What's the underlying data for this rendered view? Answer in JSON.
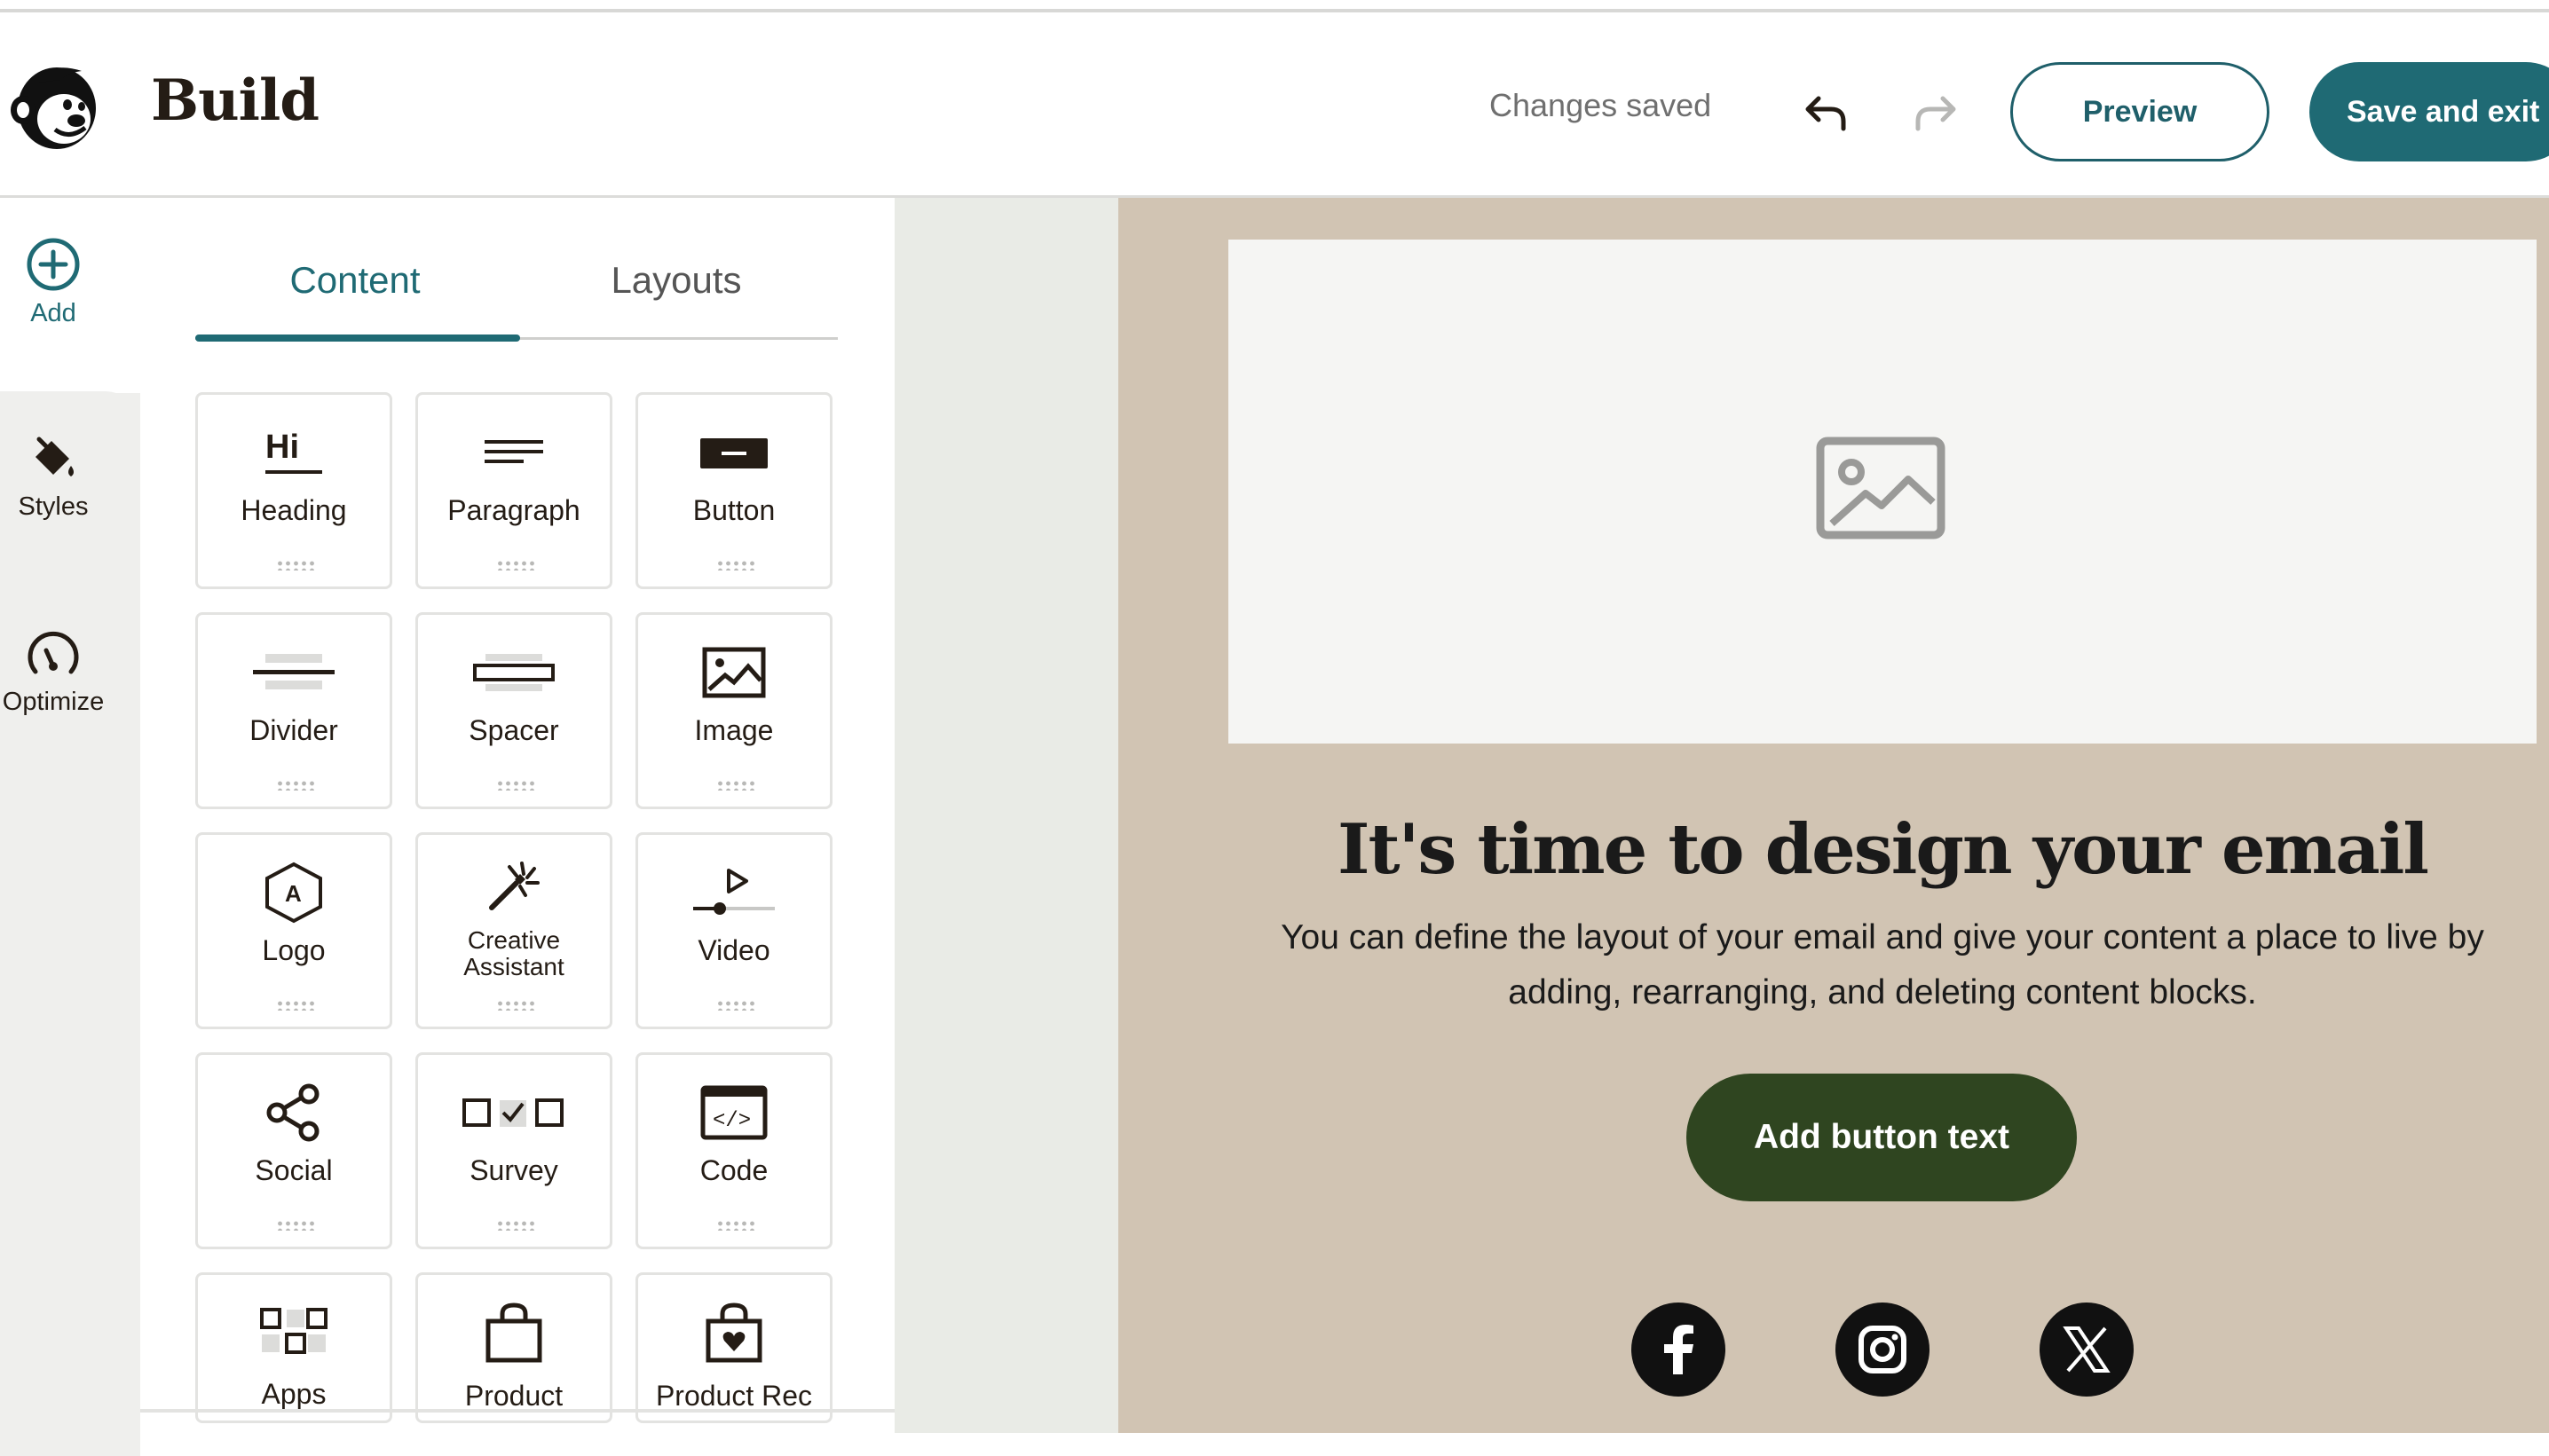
{
  "header": {
    "title": "Build",
    "status": "Changes saved",
    "preview_label": "Preview",
    "save_exit_label": "Save and exit"
  },
  "rail": {
    "items": [
      {
        "label": "Add",
        "icon": "plus-circle-icon"
      },
      {
        "label": "Styles",
        "icon": "paint-bucket-icon"
      },
      {
        "label": "Optimize",
        "icon": "gauge-icon"
      }
    ]
  },
  "panel": {
    "tabs": [
      {
        "label": "Content",
        "active": true
      },
      {
        "label": "Layouts",
        "active": false
      }
    ],
    "blocks": [
      {
        "label": "Heading",
        "icon": "heading-icon"
      },
      {
        "label": "Paragraph",
        "icon": "paragraph-icon"
      },
      {
        "label": "Button",
        "icon": "button-icon"
      },
      {
        "label": "Divider",
        "icon": "divider-icon"
      },
      {
        "label": "Spacer",
        "icon": "spacer-icon"
      },
      {
        "label": "Image",
        "icon": "image-icon"
      },
      {
        "label": "Logo",
        "icon": "logo-icon"
      },
      {
        "label": "Creative Assistant",
        "icon": "magic-wand-icon"
      },
      {
        "label": "Video",
        "icon": "video-icon"
      },
      {
        "label": "Social",
        "icon": "share-icon"
      },
      {
        "label": "Survey",
        "icon": "survey-icon"
      },
      {
        "label": "Code",
        "icon": "code-icon"
      },
      {
        "label": "Apps",
        "icon": "apps-icon"
      },
      {
        "label": "Product",
        "icon": "shopping-bag-icon"
      },
      {
        "label": "Product Rec",
        "icon": "heart-bag-icon"
      }
    ]
  },
  "email": {
    "heading": "It's time to design your email",
    "body": "You can define the layout of your email and give your content a place to live by adding, rearranging, and deleting content blocks.",
    "button_label": "Add button text",
    "social": [
      "facebook-icon",
      "instagram-icon",
      "x-icon"
    ]
  },
  "colors": {
    "accent": "#1f6a74",
    "canvas_bg": "#d1c4b3",
    "email_button": "#2f4520"
  }
}
